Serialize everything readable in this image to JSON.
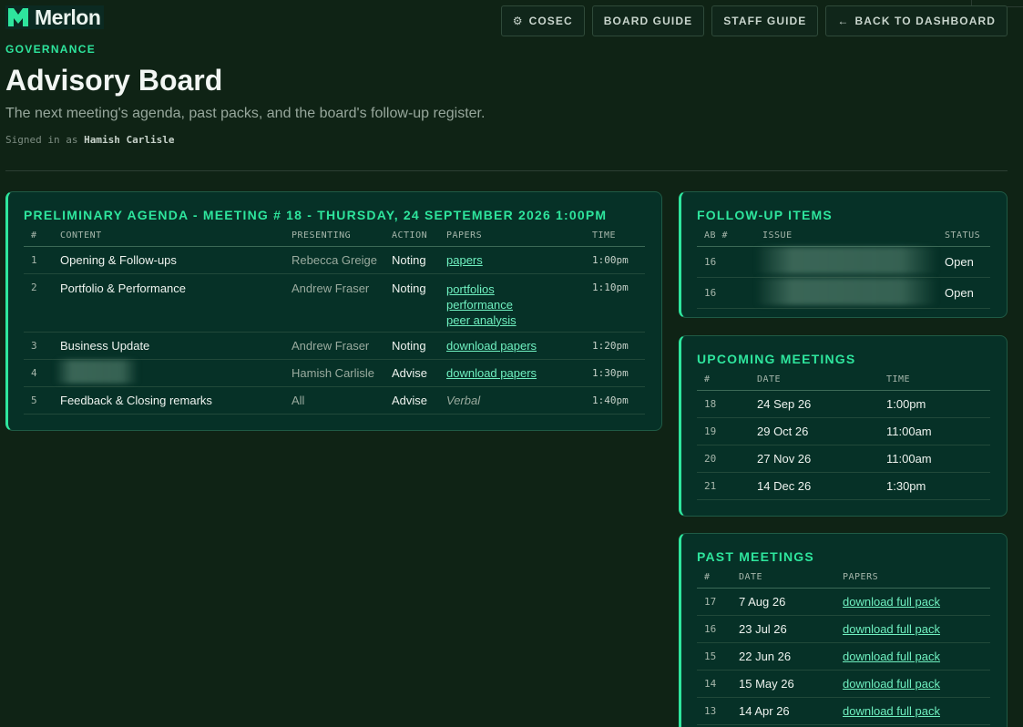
{
  "brand": {
    "name": "Merlon"
  },
  "nav": {
    "cosec": "COSEC",
    "board_guide": "BOARD GUIDE",
    "staff_guide": "STAFF GUIDE",
    "back": "BACK TO DASHBOARD"
  },
  "header": {
    "eyebrow": "GOVERNANCE",
    "title": "Advisory Board",
    "subtitle": "The next meeting's agenda, past packs, and the board's follow-up register.",
    "signed_in_prefix": "Signed in as",
    "signed_in_user": "Hamish Carlisle"
  },
  "agenda": {
    "title": "PRELIMINARY AGENDA - MEETING # 18 - THURSDAY, 24 SEPTEMBER 2026 1:00PM",
    "columns": [
      "#",
      "CONTENT",
      "PRESENTING",
      "ACTION",
      "PAPERS",
      "TIME"
    ],
    "rows": [
      {
        "num": "1",
        "content": "Opening & Follow-ups",
        "presenting": "Rebecca Greige",
        "action": "Noting",
        "papers": [
          "papers"
        ],
        "time": "1:00pm"
      },
      {
        "num": "2",
        "content": "Portfolio & Performance",
        "presenting": "Andrew Fraser",
        "action": "Noting",
        "papers": [
          "portfolios",
          "performance",
          "peer analysis"
        ],
        "time": "1:10pm"
      },
      {
        "num": "3",
        "content": "Business Update",
        "presenting": "Andrew Fraser",
        "action": "Noting",
        "papers": [
          "download papers"
        ],
        "time": "1:20pm"
      },
      {
        "num": "4",
        "content": "",
        "presenting": "Hamish Carlisle",
        "action": "Advise",
        "papers": [
          "download papers"
        ],
        "time": "1:30pm"
      },
      {
        "num": "5",
        "content": "Feedback & Closing remarks",
        "presenting": "All",
        "action": "Advise",
        "papers_note": "Verbal",
        "time": "1:40pm"
      }
    ]
  },
  "followups": {
    "title": "FOLLOW-UP ITEMS",
    "columns": [
      "AB #",
      "ISSUE",
      "STATUS"
    ],
    "rows": [
      {
        "ab": "16",
        "status": "Open"
      },
      {
        "ab": "16",
        "status": "Open"
      }
    ]
  },
  "upcoming": {
    "title": "UPCOMING MEETINGS",
    "columns": [
      "#",
      "DATE",
      "TIME"
    ],
    "rows": [
      {
        "num": "18",
        "date": "24 Sep 26",
        "time": "1:00pm"
      },
      {
        "num": "19",
        "date": "29 Oct 26",
        "time": "11:00am"
      },
      {
        "num": "20",
        "date": "27 Nov 26",
        "time": "11:00am"
      },
      {
        "num": "21",
        "date": "14 Dec 26",
        "time": "1:30pm"
      }
    ]
  },
  "past": {
    "title": "PAST MEETINGS",
    "columns": [
      "#",
      "DATE",
      "PAPERS"
    ],
    "rows": [
      {
        "num": "17",
        "date": "7 Aug 26",
        "link": "download full pack"
      },
      {
        "num": "16",
        "date": "23 Jul 26",
        "link": "download full pack"
      },
      {
        "num": "15",
        "date": "22 Jun 26",
        "link": "download full pack"
      },
      {
        "num": "14",
        "date": "15 May 26",
        "link": "download full pack"
      },
      {
        "num": "13",
        "date": "14 Apr 26",
        "link": "download full pack"
      }
    ]
  },
  "colors": {
    "accent": "#2ee59d",
    "background": "#0f2315",
    "panel": "#063127",
    "link": "#6ff0c0"
  },
  "icons": {
    "cosec": "gear-icon",
    "back": "arrow-left-icon",
    "logo": "merlon-logo-icon"
  }
}
